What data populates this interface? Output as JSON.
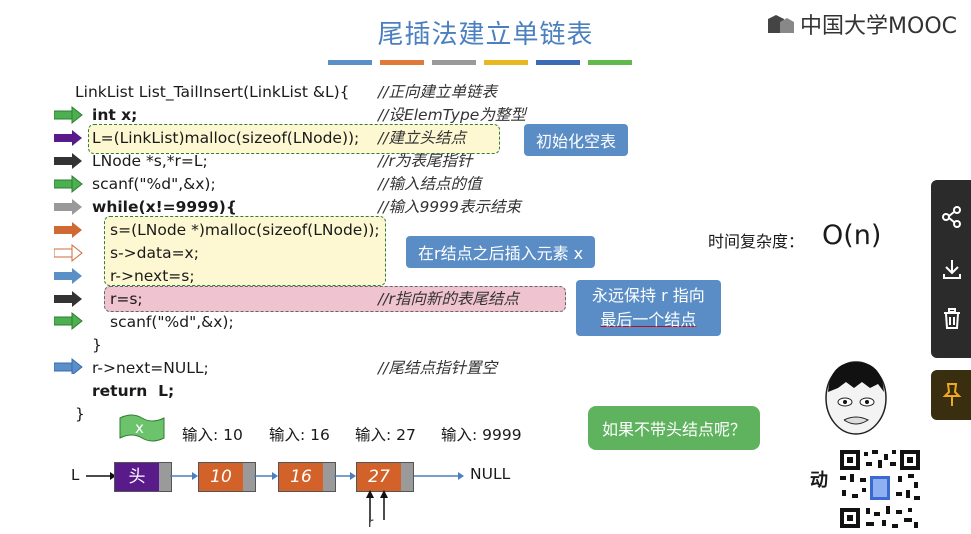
{
  "slide": {
    "title": "尾插法建立单链表",
    "logo_text": "中国大学MOOC",
    "title_bar_colors": [
      "#5b8fc7",
      "#e07a3a",
      "#9a9a9a",
      "#e8b820",
      "#3b6bb5",
      "#62b94e"
    ]
  },
  "code": {
    "lines": [
      {
        "text": "LinkList List_TailInsert(LinkList &L){",
        "comment": "//正向建立单链表"
      },
      {
        "text": "int x;",
        "comment": "//设ElemType为整型"
      },
      {
        "text": "L=(LinkList)malloc(sizeof(LNode));",
        "comment": "//建立头结点"
      },
      {
        "text": "LNode *s,*r=L;",
        "comment": "//r为表尾指针"
      },
      {
        "text": "scanf(\"%d\",&x);",
        "comment": "//输入结点的值"
      },
      {
        "text": "while(x!=9999){",
        "comment": "//输入9999表示结束"
      },
      {
        "text": "s=(LNode *)malloc(sizeof(LNode));",
        "comment": ""
      },
      {
        "text": "s->data=x;",
        "comment": ""
      },
      {
        "text": "r->next=s;",
        "comment": ""
      },
      {
        "text": "r=s;",
        "comment": "//r指向新的表尾结点"
      },
      {
        "text": "scanf(\"%d\",&x);",
        "comment": ""
      },
      {
        "text": "}",
        "comment": ""
      },
      {
        "text": "r->next=NULL;",
        "comment": "//尾结点指针置空"
      },
      {
        "text": "return  L;",
        "comment": ""
      },
      {
        "text": "}",
        "comment": ""
      }
    ]
  },
  "callouts": {
    "init_empty": "初始化空表",
    "insert_after_r": "在r结点之后插入元素 x",
    "keep_r_line1": "永远保持 r 指向",
    "keep_r_line2": "最后一个结点",
    "no_head": "如果不带头结点呢？",
    "complexity_label": "时间复杂度：",
    "complexity_value": "O(n)"
  },
  "inputs": {
    "x_label": "x",
    "values": [
      "输入: 10",
      "输入: 16",
      "输入: 27",
      "输入: 9999"
    ]
  },
  "list": {
    "L_label": "L",
    "head_label": "头",
    "nodes": [
      "10",
      "16",
      "27"
    ],
    "null_label": "NULL",
    "r_label": "r"
  },
  "sidebar": {
    "icons": [
      "share-icon",
      "download-icon",
      "delete-icon",
      "pin-icon"
    ]
  },
  "footer": {
    "action_text": "动"
  }
}
